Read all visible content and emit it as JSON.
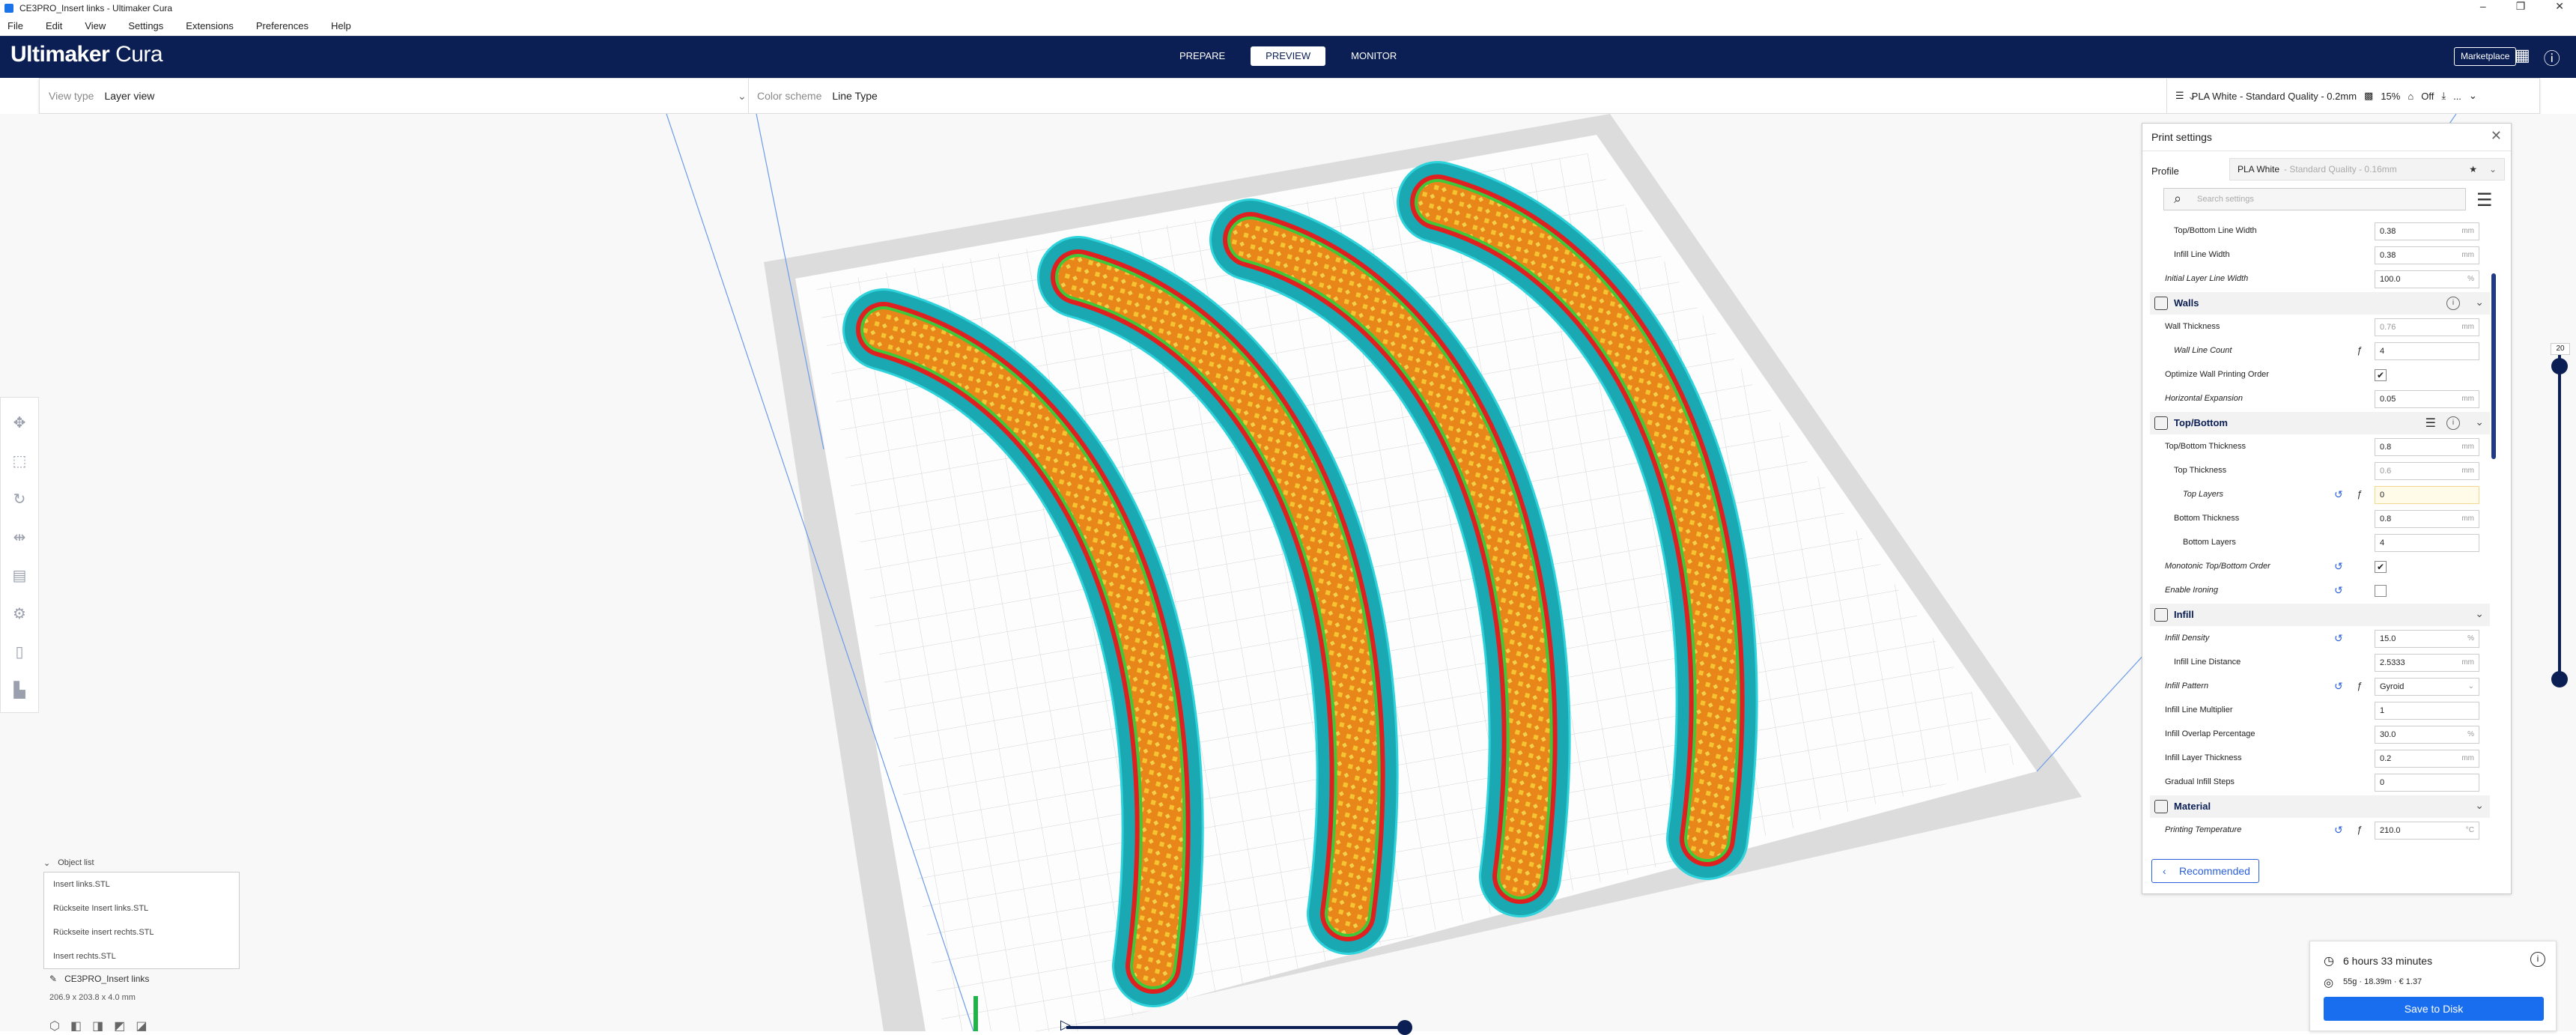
{
  "window": {
    "title": "CE3PRO_Insert links - Ultimaker Cura",
    "controls": [
      "–",
      "❐",
      "✕"
    ]
  },
  "menu": [
    "File",
    "Edit",
    "View",
    "Settings",
    "Extensions",
    "Preferences",
    "Help"
  ],
  "header": {
    "logo_bold": "Ultimaker",
    "logo_light": " Cura",
    "stages": [
      "PREPARE",
      "PREVIEW",
      "MONITOR"
    ],
    "active_stage": "PREVIEW",
    "marketplace": "Marketplace"
  },
  "stagebar": {
    "view_type_label": "View type",
    "view_type_value": "Layer view",
    "color_scheme_label": "Color scheme",
    "color_scheme_value": "Line Type",
    "profile_summary": "PLA White - Standard Quality - 0.2mm",
    "infill": "15%",
    "support": "Off",
    "more": "..."
  },
  "object_list": {
    "title": "Object list",
    "items": [
      "Insert links.STL",
      "Rückseite Insert links.STL",
      "Rückseite insert rechts.STL",
      "Insert rechts.STL"
    ],
    "current_name": "CE3PRO_Insert links",
    "dimensions": "206.9 x 203.8 x 4.0 mm"
  },
  "print_settings": {
    "title": "Print settings",
    "profile_label": "Profile",
    "profile_value": "PLA White",
    "profile_sub": "- Standard Quality - 0.16mm",
    "search_placeholder": "Search settings",
    "recommended": "Recommended",
    "rows": [
      {
        "kind": "setting",
        "label": "Top/Bottom Line Width",
        "value": "0.38",
        "unit": "mm",
        "indent": 1
      },
      {
        "kind": "setting",
        "label": "Infill Line Width",
        "value": "0.38",
        "unit": "mm",
        "indent": 1
      },
      {
        "kind": "setting",
        "label": "Initial Layer Line Width",
        "value": "100.0",
        "unit": "%",
        "indent": 0,
        "italic": true
      },
      {
        "kind": "category",
        "label": "Walls",
        "icon": "walls-icon",
        "info": true
      },
      {
        "kind": "setting",
        "label": "Wall Thickness",
        "value": "0.76",
        "unit": "mm",
        "indent": 0,
        "gray": true
      },
      {
        "kind": "setting",
        "label": "Wall Line Count",
        "value": "4",
        "unit": "",
        "indent": 1,
        "fx": true,
        "italic": true
      },
      {
        "kind": "check",
        "label": "Optimize Wall Printing Order",
        "checked": true,
        "indent": 0
      },
      {
        "kind": "setting",
        "label": "Horizontal Expansion",
        "value": "0.05",
        "unit": "mm",
        "indent": 0,
        "italic": true
      },
      {
        "kind": "category",
        "label": "Top/Bottom",
        "icon": "topbottom-icon",
        "info": true,
        "lines": true
      },
      {
        "kind": "setting",
        "label": "Top/Bottom Thickness",
        "value": "0.8",
        "unit": "mm",
        "indent": 0
      },
      {
        "kind": "setting",
        "label": "Top Thickness",
        "value": "0.6",
        "unit": "mm",
        "indent": 1,
        "gray": true
      },
      {
        "kind": "setting",
        "label": "Top Layers",
        "value": "0",
        "unit": "",
        "indent": 2,
        "reset": true,
        "fx": true,
        "highlight": true,
        "italic": true
      },
      {
        "kind": "setting",
        "label": "Bottom Thickness",
        "value": "0.8",
        "unit": "mm",
        "indent": 1
      },
      {
        "kind": "setting",
        "label": "Bottom Layers",
        "value": "4",
        "unit": "",
        "indent": 2
      },
      {
        "kind": "check",
        "label": "Monotonic Top/Bottom Order",
        "checked": true,
        "reset": true,
        "indent": 0,
        "italic": true
      },
      {
        "kind": "check",
        "label": "Enable Ironing",
        "checked": false,
        "reset": true,
        "indent": 0,
        "italic": true
      },
      {
        "kind": "category",
        "label": "Infill",
        "icon": "infill-icon"
      },
      {
        "kind": "setting",
        "label": "Infill Density",
        "value": "15.0",
        "unit": "%",
        "indent": 0,
        "reset": true,
        "italic": true
      },
      {
        "kind": "setting",
        "label": "Infill Line Distance",
        "value": "2.5333",
        "unit": "mm",
        "indent": 1
      },
      {
        "kind": "setting",
        "label": "Infill Pattern",
        "value": "Gyroid",
        "unit": "⌄",
        "indent": 0,
        "reset": true,
        "fx": true,
        "italic": true
      },
      {
        "kind": "setting",
        "label": "Infill Line Multiplier",
        "value": "1",
        "unit": "",
        "indent": 0
      },
      {
        "kind": "setting",
        "label": "Infill Overlap Percentage",
        "value": "30.0",
        "unit": "%",
        "indent": 0
      },
      {
        "kind": "setting",
        "label": "Infill Layer Thickness",
        "value": "0.2",
        "unit": "mm",
        "indent": 0
      },
      {
        "kind": "setting",
        "label": "Gradual Infill Steps",
        "value": "0",
        "unit": "",
        "indent": 0
      },
      {
        "kind": "category",
        "label": "Material",
        "icon": "material-icon"
      },
      {
        "kind": "setting",
        "label": "Printing Temperature",
        "value": "210.0",
        "unit": "°C",
        "indent": 0,
        "reset": true,
        "fx": true,
        "italic": true
      }
    ]
  },
  "layer_slider": {
    "value": "20"
  },
  "slice_info": {
    "time": "6 hours 33 minutes",
    "material": "55g · 18.39m · € 1.37",
    "save": "Save to Disk"
  },
  "colors": {
    "header": "#0b1f54",
    "accent": "#196ef0",
    "shell": "#2ed3dc",
    "wall": "#e02020",
    "infill": "#e8861a",
    "inner": "#3fc83a"
  }
}
